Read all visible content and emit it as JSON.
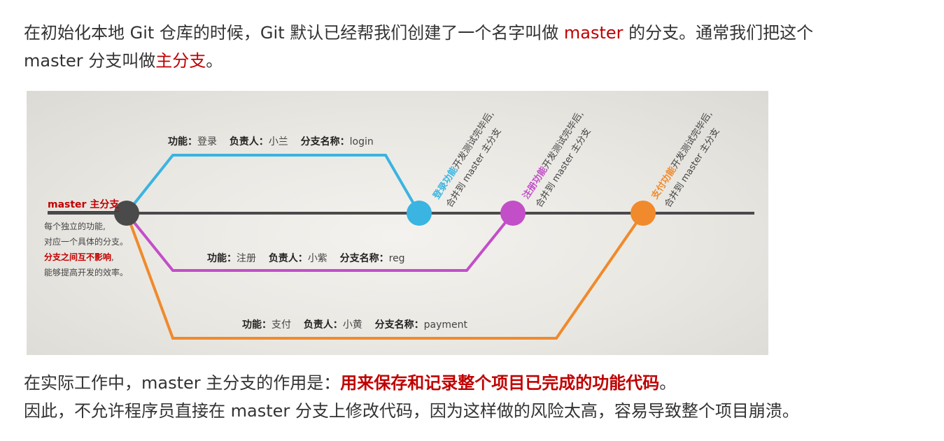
{
  "intro": {
    "part1": "在初始化本地 Git 仓库的时候，Git 默认已经帮我们创建了一个名字叫做 ",
    "master_word": "master",
    "part2": " 的分支。通常我们把这个",
    "part3": "master 分支叫做",
    "main_branch_word": "主分支",
    "part4": "。"
  },
  "diagram": {
    "master": {
      "title": "master 主分支",
      "note1": "每个独立的功能,",
      "note2": "对应一个具体的分支。",
      "note3": "分支之间互不影响",
      "note3_tail": ",",
      "note4": "能够提高开发的效率。"
    },
    "branches": [
      {
        "feature_key": "功能：",
        "feature": "登录",
        "owner_key": "负责人：",
        "owner": "小兰",
        "name_key": "分支名称：",
        "name": "login",
        "color": "#3ab4e0",
        "merge_highlight": "登录功能",
        "merge_tail": "开发测试完毕后,",
        "merge_line2": "合并到 master 主分支"
      },
      {
        "feature_key": "功能：",
        "feature": "注册",
        "owner_key": "负责人：",
        "owner": "小紫",
        "name_key": "分支名称：",
        "name": "reg",
        "color": "#c24ec8",
        "merge_highlight": "注册功能",
        "merge_tail": "开发测试完毕后,",
        "merge_line2": "合并到 master 主分支"
      },
      {
        "feature_key": "功能：",
        "feature": "支付",
        "owner_key": "负责人：",
        "owner": "小黄",
        "name_key": "分支名称：",
        "name": "payment",
        "color": "#f08a2c",
        "merge_highlight": "支付功能",
        "merge_tail": "开发测试完毕后,",
        "merge_line2": "合并到 master 主分支"
      }
    ]
  },
  "outro": {
    "line1_part1": "在实际工作中，master 主分支的作用是：",
    "line1_bold": "用来保存和记录整个项目已完成的功能代码",
    "line1_end": "。",
    "line2": "因此，不允许程序员直接在 master 分支上修改代码，因为这样做的风险太高，容易导致整个项目崩溃。"
  }
}
